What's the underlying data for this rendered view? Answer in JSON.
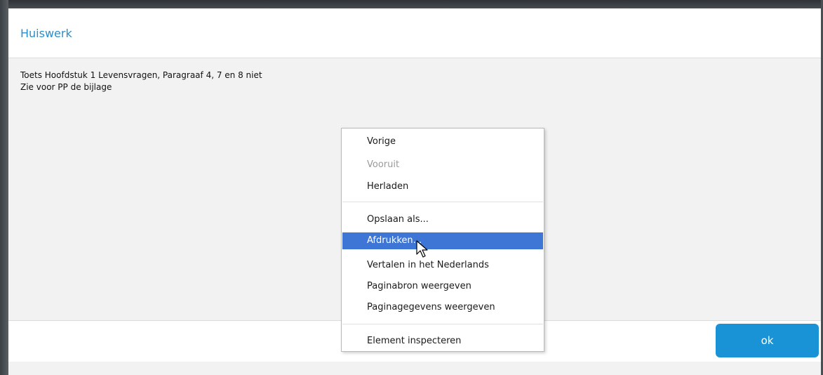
{
  "dialog": {
    "title": "Huiswerk",
    "body_lines": [
      "Toets Hoofdstuk 1 Levensvragen, Paragraaf 4, 7 en 8 niet",
      "Zie voor PP de bijlage"
    ],
    "ok_label": "ok"
  },
  "context_menu": {
    "items": [
      {
        "label": "Vorige",
        "state": "enabled"
      },
      {
        "label": "Vooruit",
        "state": "disabled"
      },
      {
        "label": "Herladen",
        "state": "enabled"
      },
      {
        "label": "Opslaan als...",
        "state": "enabled"
      },
      {
        "label": "Afdrukken...",
        "state": "highlighted"
      },
      {
        "label": "Vertalen in het Nederlands",
        "state": "enabled"
      },
      {
        "label": "Paginabron weergeven",
        "state": "enabled"
      },
      {
        "label": "Paginagegevens weergeven",
        "state": "enabled"
      },
      {
        "label": "Element inspecteren",
        "state": "enabled"
      }
    ]
  },
  "colors": {
    "title": "#2b8ec9",
    "ok_button": "#1a93d6",
    "menu_highlight": "#3d76d4",
    "body_background": "#f2f2f2"
  },
  "icons": {
    "cursor": "arrow-cursor-icon"
  }
}
